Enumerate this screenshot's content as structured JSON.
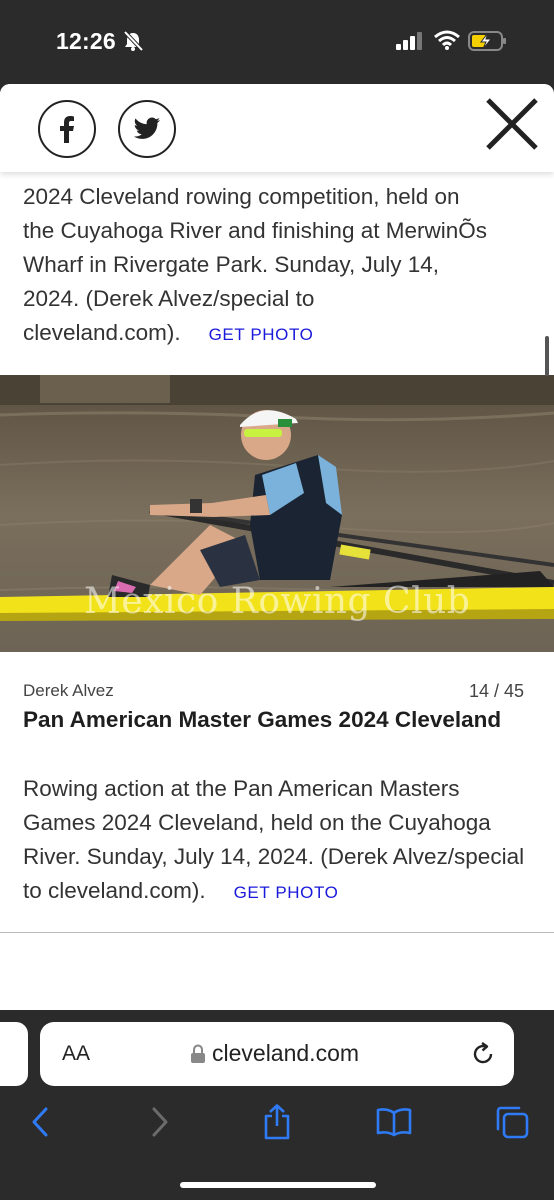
{
  "status": {
    "time": "12:26"
  },
  "share": {
    "facebook_icon": "facebook-icon",
    "twitter_icon": "twitter-icon",
    "close_icon": "close-icon"
  },
  "prev_caption": {
    "line1": "2024 Cleveland rowing competition, held on",
    "line2": "the Cuyahoga River and finishing at MerwinÕs",
    "line3": "Wharf in Rivergate Park. Sunday, July 14,",
    "line4": "2024. (Derek Alvez/special to",
    "line5": "cleveland.com).",
    "get_photo": "GET PHOTO"
  },
  "photo": {
    "watermark": "Mexico Rowing Club"
  },
  "slide": {
    "credit": "Derek Alvez",
    "counter": "14 / 45",
    "title": "Pan American Master Games 2024 Cleveland",
    "caption": "Rowing action at the Pan American Masters Games 2024 Cleveland, held on the Cuyahoga River. Sunday, July 14, 2024. (Derek Alvez/special to cleveland.com).",
    "get_photo": "GET PHOTO"
  },
  "browser": {
    "text_size": "AA",
    "url": "cleveland.com"
  },
  "colors": {
    "link": "#1a1adb",
    "chrome_bg": "#2b2b2b",
    "boat": "#f2e21a"
  }
}
